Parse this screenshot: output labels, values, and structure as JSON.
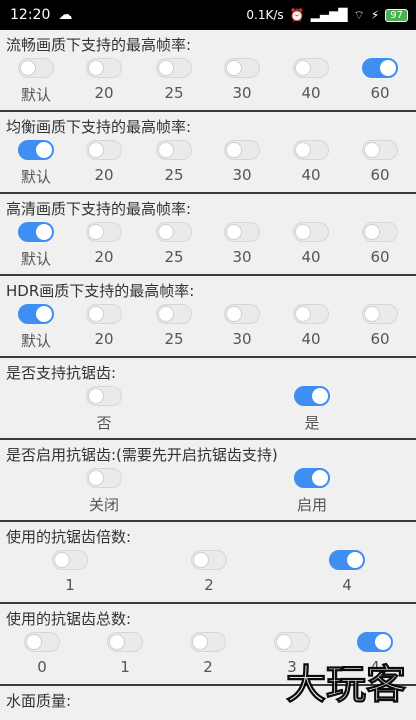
{
  "statusbar": {
    "time": "12:20",
    "cloud_icon": "cloud-icon",
    "speed": "0.1K/s",
    "battery": "97",
    "icons": [
      "alarm-icon",
      "signal-icon",
      "wifi-icon",
      "charging-icon"
    ]
  },
  "sections": [
    {
      "title": "流畅画质下支持的最高帧率:",
      "options": [
        "默认",
        "20",
        "25",
        "30",
        "40",
        "60"
      ],
      "selected": 5
    },
    {
      "title": "均衡画质下支持的最高帧率:",
      "options": [
        "默认",
        "20",
        "25",
        "30",
        "40",
        "60"
      ],
      "selected": 0
    },
    {
      "title": "高清画质下支持的最高帧率:",
      "options": [
        "默认",
        "20",
        "25",
        "30",
        "40",
        "60"
      ],
      "selected": 0
    },
    {
      "title": "HDR画质下支持的最高帧率:",
      "options": [
        "默认",
        "20",
        "25",
        "30",
        "40",
        "60"
      ],
      "selected": 0
    },
    {
      "title": "是否支持抗锯齿:",
      "options": [
        "否",
        "是"
      ],
      "selected": 1
    },
    {
      "title": "是否启用抗锯齿:(需要先开启抗锯齿支持)",
      "options": [
        "关闭",
        "启用"
      ],
      "selected": 1
    },
    {
      "title": "使用的抗锯齿倍数:",
      "options": [
        "1",
        "2",
        "4"
      ],
      "selected": 2
    },
    {
      "title": "使用的抗锯齿总数:",
      "options": [
        "0",
        "1",
        "2",
        "3",
        "4"
      ],
      "selected": 4
    },
    {
      "title": "水面质量:",
      "options": [],
      "selected": -1
    }
  ],
  "watermark": "大玩客"
}
